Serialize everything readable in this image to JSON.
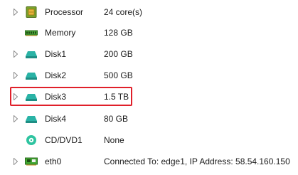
{
  "hardware": {
    "items": [
      {
        "name": "Processor",
        "value": "24 core(s)",
        "icon": "cpu-icon",
        "expandable": true
      },
      {
        "name": "Memory",
        "value": "128 GB",
        "icon": "memory-icon",
        "expandable": false
      },
      {
        "name": "Disk1",
        "value": "200 GB",
        "icon": "disk-icon",
        "expandable": true
      },
      {
        "name": "Disk2",
        "value": "500 GB",
        "icon": "disk-icon",
        "expandable": true
      },
      {
        "name": "Disk3",
        "value": "1.5 TB",
        "icon": "disk-icon",
        "expandable": true,
        "highlighted": true
      },
      {
        "name": "Disk4",
        "value": "80 GB",
        "icon": "disk-icon",
        "expandable": true
      },
      {
        "name": "CD/DVD1",
        "value": "None",
        "icon": "cd-dvd-icon",
        "expandable": false
      },
      {
        "name": "eth0",
        "value": "Connected To: edge1, IP Address: 58.54.160.150",
        "icon": "network-adapter-icon",
        "expandable": true
      }
    ]
  },
  "colors": {
    "highlight_border": "#e0202a",
    "disk_icon": "#2ab3a6",
    "cd_icon": "#2ec4a0",
    "cpu_icon": "#6a8f1f",
    "memory_icon": "#3c9a2e",
    "network_icon": "#38a030"
  }
}
